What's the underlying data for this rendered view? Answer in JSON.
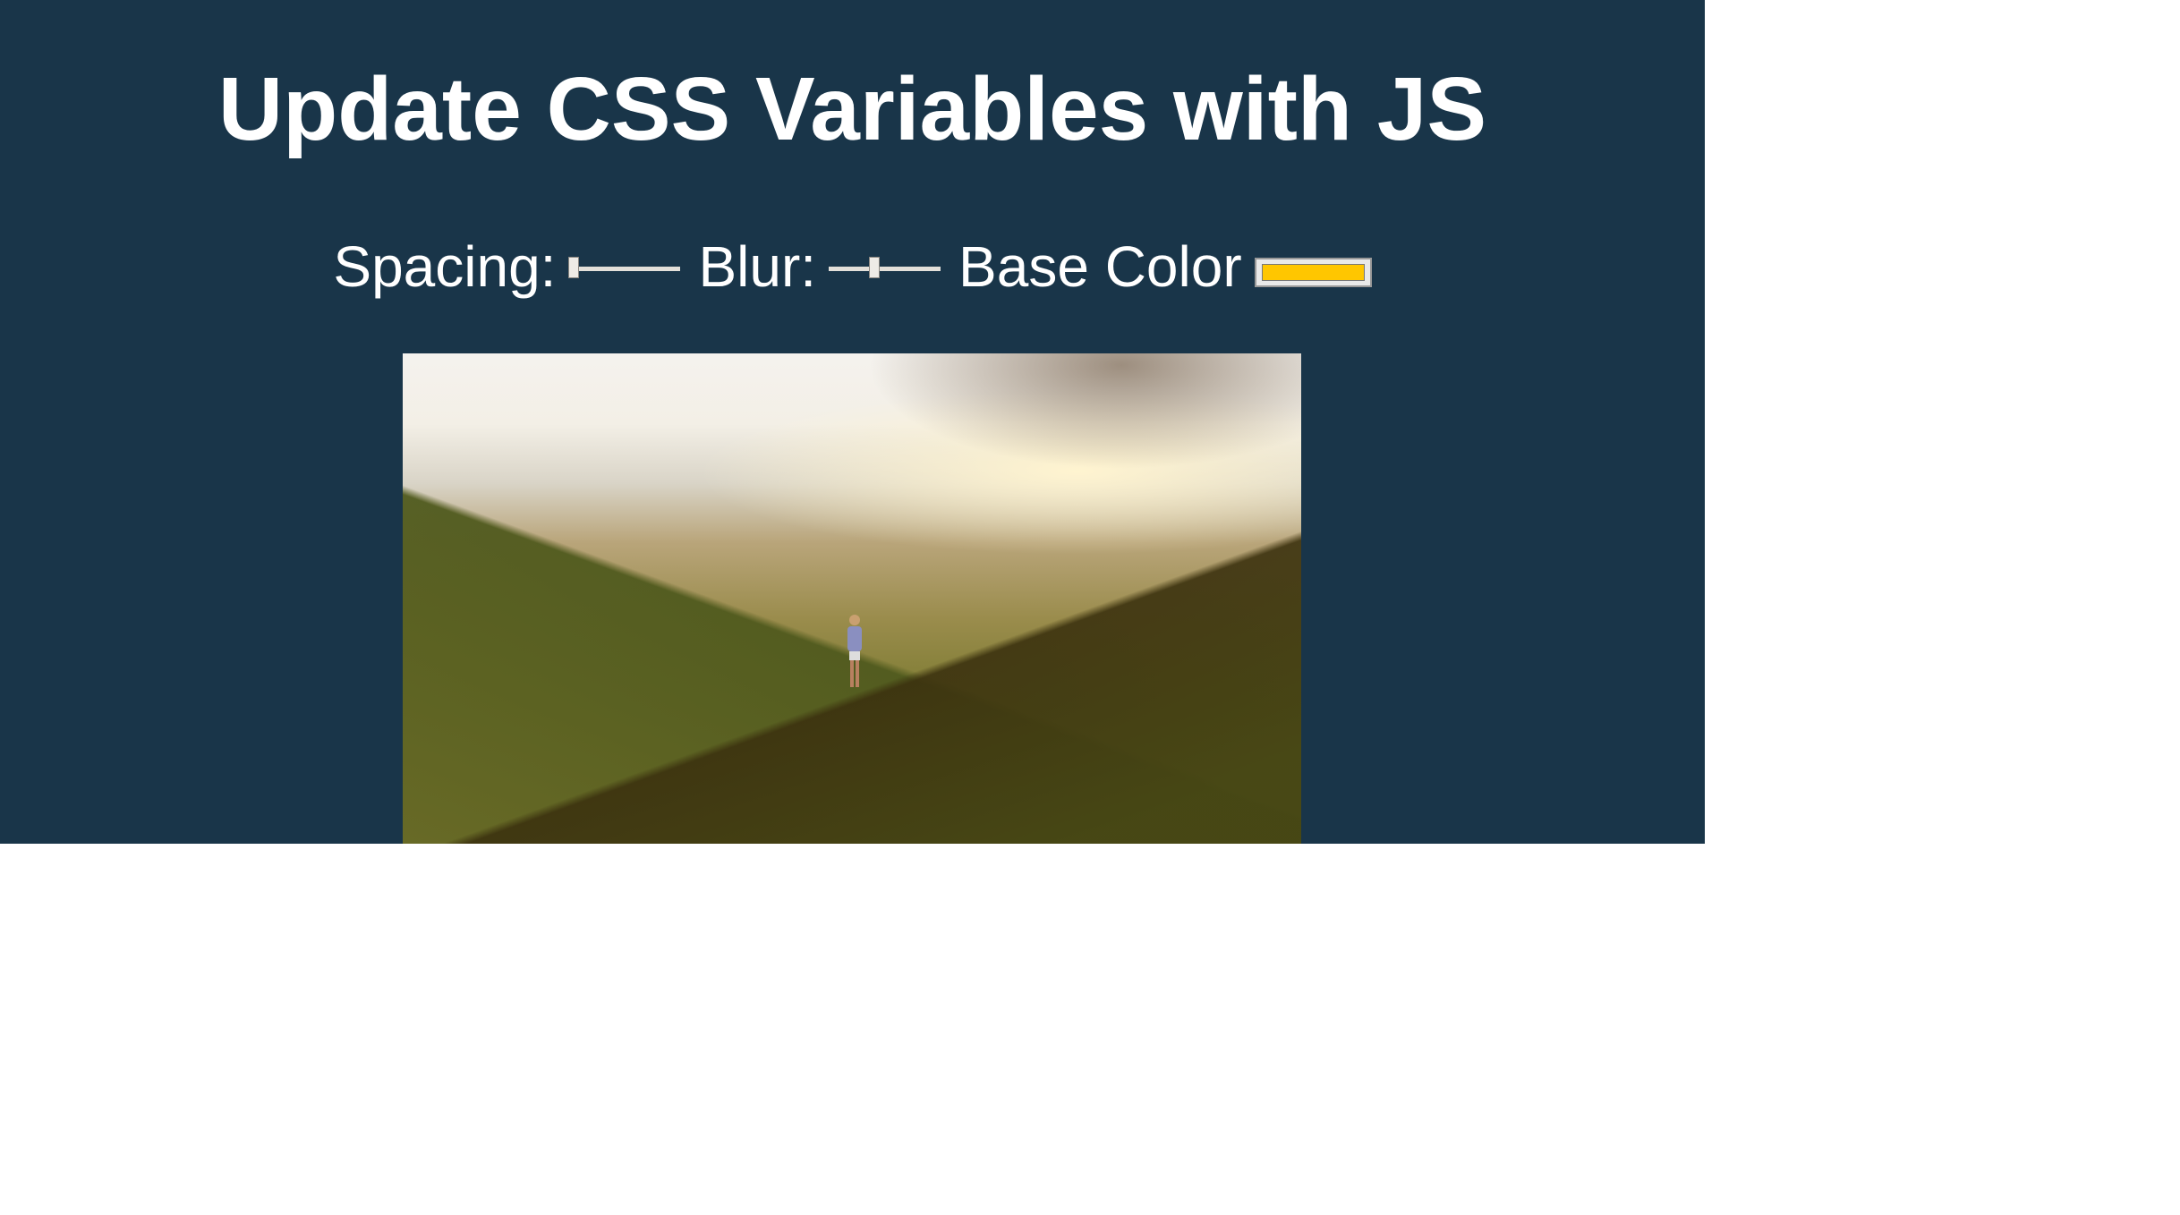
{
  "title": "Update CSS Variables with JS",
  "controls": {
    "spacing_label": "Spacing:",
    "spacing_value_fraction": 0.0,
    "blur_label": "Blur:",
    "blur_value_fraction": 0.4,
    "base_color_label": "Base Color",
    "base_color_value": "#ffc600"
  },
  "colors": {
    "background": "#193549",
    "text": "#ffffff"
  }
}
